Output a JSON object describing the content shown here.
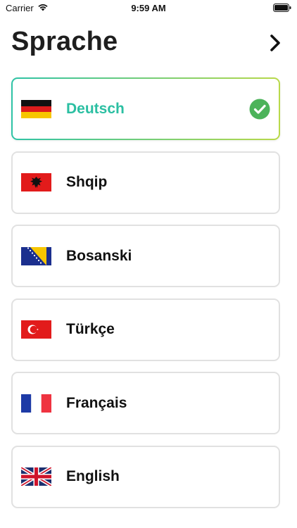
{
  "status_bar": {
    "carrier": "Carrier",
    "time": "9:59 AM",
    "icons": [
      "wifi-icon",
      "battery-icon"
    ]
  },
  "header": {
    "title": "Sprache",
    "next_icon": "chevron-right-icon"
  },
  "languages": [
    {
      "label": "Deutsch",
      "flag": "flag-germany-icon",
      "selected": true
    },
    {
      "label": "Shqip",
      "flag": "flag-albania-icon",
      "selected": false
    },
    {
      "label": "Bosanski",
      "flag": "flag-bosnia-icon",
      "selected": false
    },
    {
      "label": "Türkçe",
      "flag": "flag-turkey-icon",
      "selected": false
    },
    {
      "label": "Français",
      "flag": "flag-france-icon",
      "selected": false
    },
    {
      "label": "English",
      "flag": "flag-uk-icon",
      "selected": false
    }
  ],
  "colors": {
    "accent": "#2bbfa2",
    "accent_end": "#b9d94a",
    "check": "#4cb35a",
    "card_border": "#e1e1e1"
  }
}
